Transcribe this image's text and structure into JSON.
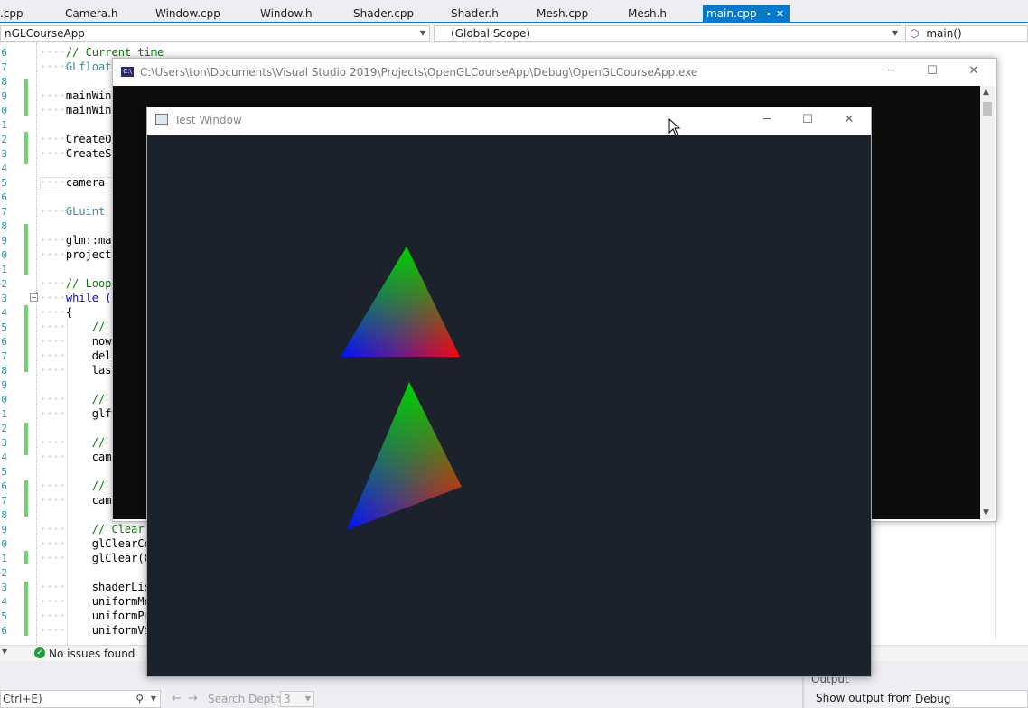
{
  "tabs": [
    {
      "label": ".cpp"
    },
    {
      "label": "Camera.h"
    },
    {
      "label": "Window.cpp"
    },
    {
      "label": "Window.h"
    },
    {
      "label": "Shader.cpp"
    },
    {
      "label": "Shader.h"
    },
    {
      "label": "Mesh.cpp"
    },
    {
      "label": "Mesh.h"
    },
    {
      "label": "main.cpp",
      "active": true
    }
  ],
  "navbar": {
    "project": "nGLCourseApp",
    "scope": "(Global Scope)",
    "member": "main()"
  },
  "editor": {
    "lines": [
      {
        "num": "6",
        "text": "// Current time",
        "style": "comment"
      },
      {
        "num": "7",
        "text": "GLfloat",
        "style": "type"
      },
      {
        "num": "8",
        "text": "",
        "style": "plain"
      },
      {
        "num": "9",
        "text": "mainWind",
        "style": "plain"
      },
      {
        "num": "0",
        "text": "mainWind",
        "style": "plain"
      },
      {
        "num": "1",
        "text": "",
        "style": "plain"
      },
      {
        "num": "2",
        "text": "CreateOb",
        "style": "plain"
      },
      {
        "num": "3",
        "text": "CreateSh",
        "style": "plain"
      },
      {
        "num": "4",
        "text": "",
        "style": "plain"
      },
      {
        "num": "5",
        "text": "camera =",
        "style": "plain"
      },
      {
        "num": "6",
        "text": "",
        "style": "plain"
      },
      {
        "num": "7",
        "text": "GLuint u",
        "style": "type"
      },
      {
        "num": "8",
        "text": "",
        "style": "plain"
      },
      {
        "num": "9",
        "text": "glm::mat",
        "style": "plain"
      },
      {
        "num": "0",
        "text": "projecti",
        "style": "plain"
      },
      {
        "num": "1",
        "text": "",
        "style": "plain"
      },
      {
        "num": "2",
        "text": "// Loop",
        "style": "comment"
      },
      {
        "num": "3",
        "text": "while (",
        "style": "keyword"
      },
      {
        "num": "4",
        "text": "{",
        "style": "plain"
      },
      {
        "num": "5",
        "text": "    // G",
        "style": "comment"
      },
      {
        "num": "6",
        "text": "    now",
        "style": "plain"
      },
      {
        "num": "7",
        "text": "    delt",
        "style": "plain"
      },
      {
        "num": "8",
        "text": "    last",
        "style": "plain"
      },
      {
        "num": "9",
        "text": "",
        "style": "plain"
      },
      {
        "num": "0",
        "text": "    // G",
        "style": "comment"
      },
      {
        "num": "1",
        "text": "    glfw",
        "style": "plain"
      },
      {
        "num": "2",
        "text": "",
        "style": "plain"
      },
      {
        "num": "3",
        "text": "    // C",
        "style": "comment"
      },
      {
        "num": "4",
        "text": "    came",
        "style": "plain"
      },
      {
        "num": "5",
        "text": "",
        "style": "plain"
      },
      {
        "num": "6",
        "text": "    // C",
        "style": "comment"
      },
      {
        "num": "7",
        "text": "    came",
        "style": "plain"
      },
      {
        "num": "8",
        "text": "",
        "style": "plain"
      },
      {
        "num": "9",
        "text": "    // Clear",
        "style": "comment"
      },
      {
        "num": "0",
        "text": "    glClearCo",
        "style": "plain"
      },
      {
        "num": "1",
        "text": "    glClear(G",
        "style": "plain"
      },
      {
        "num": "2",
        "text": "",
        "style": "plain"
      },
      {
        "num": "3",
        "text": "    shaderLis",
        "style": "plain"
      },
      {
        "num": "4",
        "text": "    uniformMo",
        "style": "plain"
      },
      {
        "num": "5",
        "text": "    uniformPr",
        "style": "plain"
      },
      {
        "num": "6",
        "text": "    uniformVi",
        "style": "plain"
      }
    ]
  },
  "status": {
    "issues": "No issues found"
  },
  "bottom": {
    "search_text": "Ctrl+E)",
    "search_depth_label": "Search Depth:",
    "search_depth_value": "3",
    "output_label": "Output",
    "show_output_from": "Show output from:",
    "output_source": "Debug"
  },
  "console_window": {
    "title": "C:\\Users\\ton\\Documents\\Visual Studio 2019\\Projects\\OpenGLCourseApp\\Debug\\OpenGLCourseApp.exe",
    "icon_label": "C:\\"
  },
  "gl_window": {
    "title": "Test Window",
    "background": "#1b222b"
  },
  "icons": {
    "minimize": "─",
    "maximize": "☐",
    "close": "✕"
  }
}
